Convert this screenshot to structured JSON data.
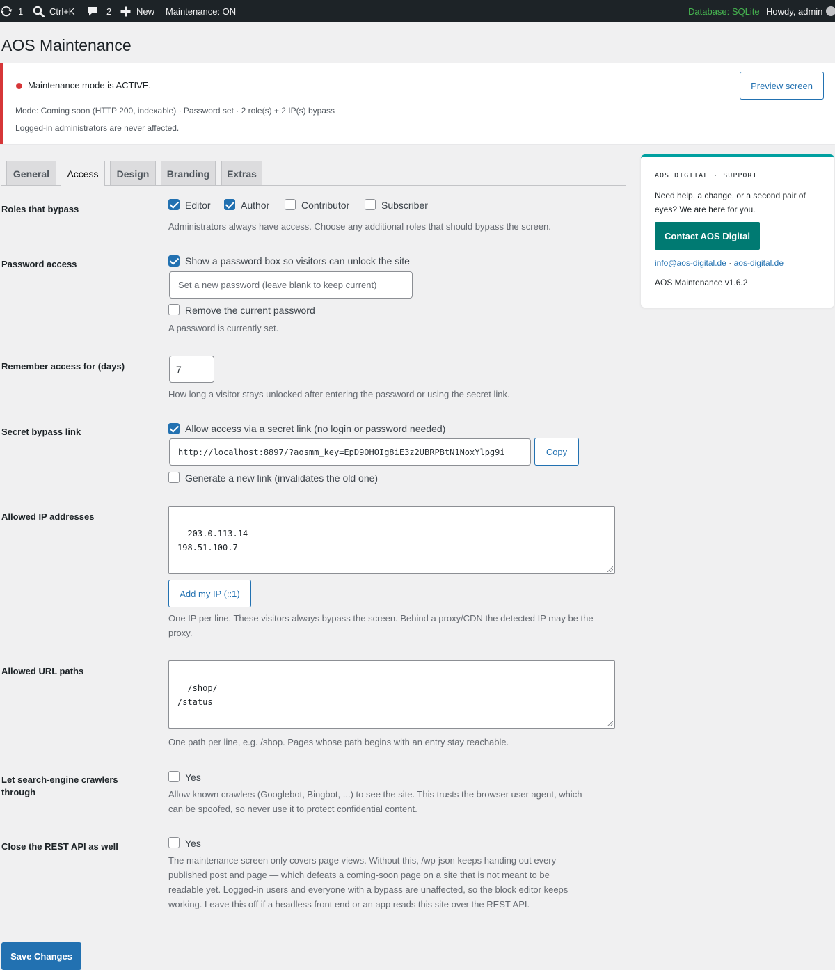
{
  "admin_bar": {
    "updates_count": "1",
    "search_shortcut": "Ctrl+K",
    "comments_count": "2",
    "new_label": "New",
    "maintenance_status": "Maintenance: ON",
    "database_label": "Database: SQLite",
    "greeting": "Howdy, admin"
  },
  "page_title": "AOS Maintenance",
  "notice": {
    "status": "Maintenance mode is ACTIVE.",
    "summary": "Mode: Coming soon (HTTP 200, indexable) · Password set · 2 role(s) + 2 IP(s) bypass",
    "note": "Logged-in administrators are never affected.",
    "preview_button": "Preview screen",
    "status_color": "#d63638"
  },
  "tabs": [
    {
      "label": "General",
      "active": false
    },
    {
      "label": "Access",
      "active": true
    },
    {
      "label": "Design",
      "active": false
    },
    {
      "label": "Branding",
      "active": false
    },
    {
      "label": "Extras",
      "active": false
    }
  ],
  "form": {
    "roles": {
      "label": "Roles that bypass",
      "options": [
        {
          "label": "Editor",
          "checked": true
        },
        {
          "label": "Author",
          "checked": true
        },
        {
          "label": "Contributor",
          "checked": false
        },
        {
          "label": "Subscriber",
          "checked": false
        }
      ],
      "description": "Administrators always have access. Choose any additional roles that should bypass the screen."
    },
    "password": {
      "label": "Password access",
      "show_box_label": "Show a password box so visitors can unlock the site",
      "show_box_checked": true,
      "input_placeholder": "Set a new password (leave blank to keep current)",
      "remove_label": "Remove the current password",
      "remove_checked": false,
      "description": "A password is currently set."
    },
    "remember": {
      "label": "Remember access for (days)",
      "value": "7",
      "description": "How long a visitor stays unlocked after entering the password or using the secret link."
    },
    "secret_link": {
      "label": "Secret bypass link",
      "allow_label": "Allow access via a secret link (no login or password needed)",
      "allow_checked": true,
      "url": "http://localhost:8897/?aosmm_key=EpD9OHOIg8iE3z2UBRPBtN1NoxYlpg9i",
      "copy_button": "Copy",
      "regenerate_label": "Generate a new link (invalidates the old one)",
      "regenerate_checked": false
    },
    "allowed_ips": {
      "label": "Allowed IP addresses",
      "value": "203.0.113.14\n198.51.100.7",
      "add_button": "Add my IP (::1)",
      "description_line1": "One IP per line. These visitors always bypass the screen. Behind a proxy/CDN the detected IP may be the",
      "description_line2": "proxy."
    },
    "allowed_paths": {
      "label": "Allowed URL paths",
      "value": "/shop/\n/status",
      "description": "One path per line, e.g. /shop. Pages whose path begins with an entry stay reachable."
    },
    "crawlers": {
      "label_line1": "Let search-engine crawlers",
      "label_line2": "through",
      "option_label": "Yes",
      "checked": false,
      "description_line1": "Allow known crawlers (Googlebot, Bingbot, ...) to see the site. This trusts the browser user agent, which",
      "description_line2": "can be spoofed, so never use it to protect confidential content."
    },
    "rest_api": {
      "label": "Close the REST API as well",
      "option_label": "Yes",
      "checked": false,
      "description_line1": "The maintenance screen only covers page views. Without this, /wp-json keeps handing out every",
      "description_line2": "published post and page — which defeats a coming-soon page on a site that is not meant to be",
      "description_line3": "readable yet. Logged-in users and everyone with a bypass are unaffected, so the block editor keeps",
      "description_line4": "working. Leave this off if a headless front end or an app reads this site over the REST API."
    },
    "save_button": "Save Changes"
  },
  "support_card": {
    "eyebrow": "AOS DIGITAL · SUPPORT",
    "text": "Need help, a change, or a second pair of eyes? We are here for you.",
    "contact_button": "Contact AOS Digital",
    "email_link": "info@aos-digital.de",
    "separator": "·",
    "site_link": "aos-digital.de",
    "version": "AOS Maintenance v1.6.2",
    "accent_color": "#007a72"
  },
  "icons": {
    "updates": "updates-icon",
    "search": "search-icon",
    "comments": "comment-icon",
    "new": "plus-icon"
  }
}
